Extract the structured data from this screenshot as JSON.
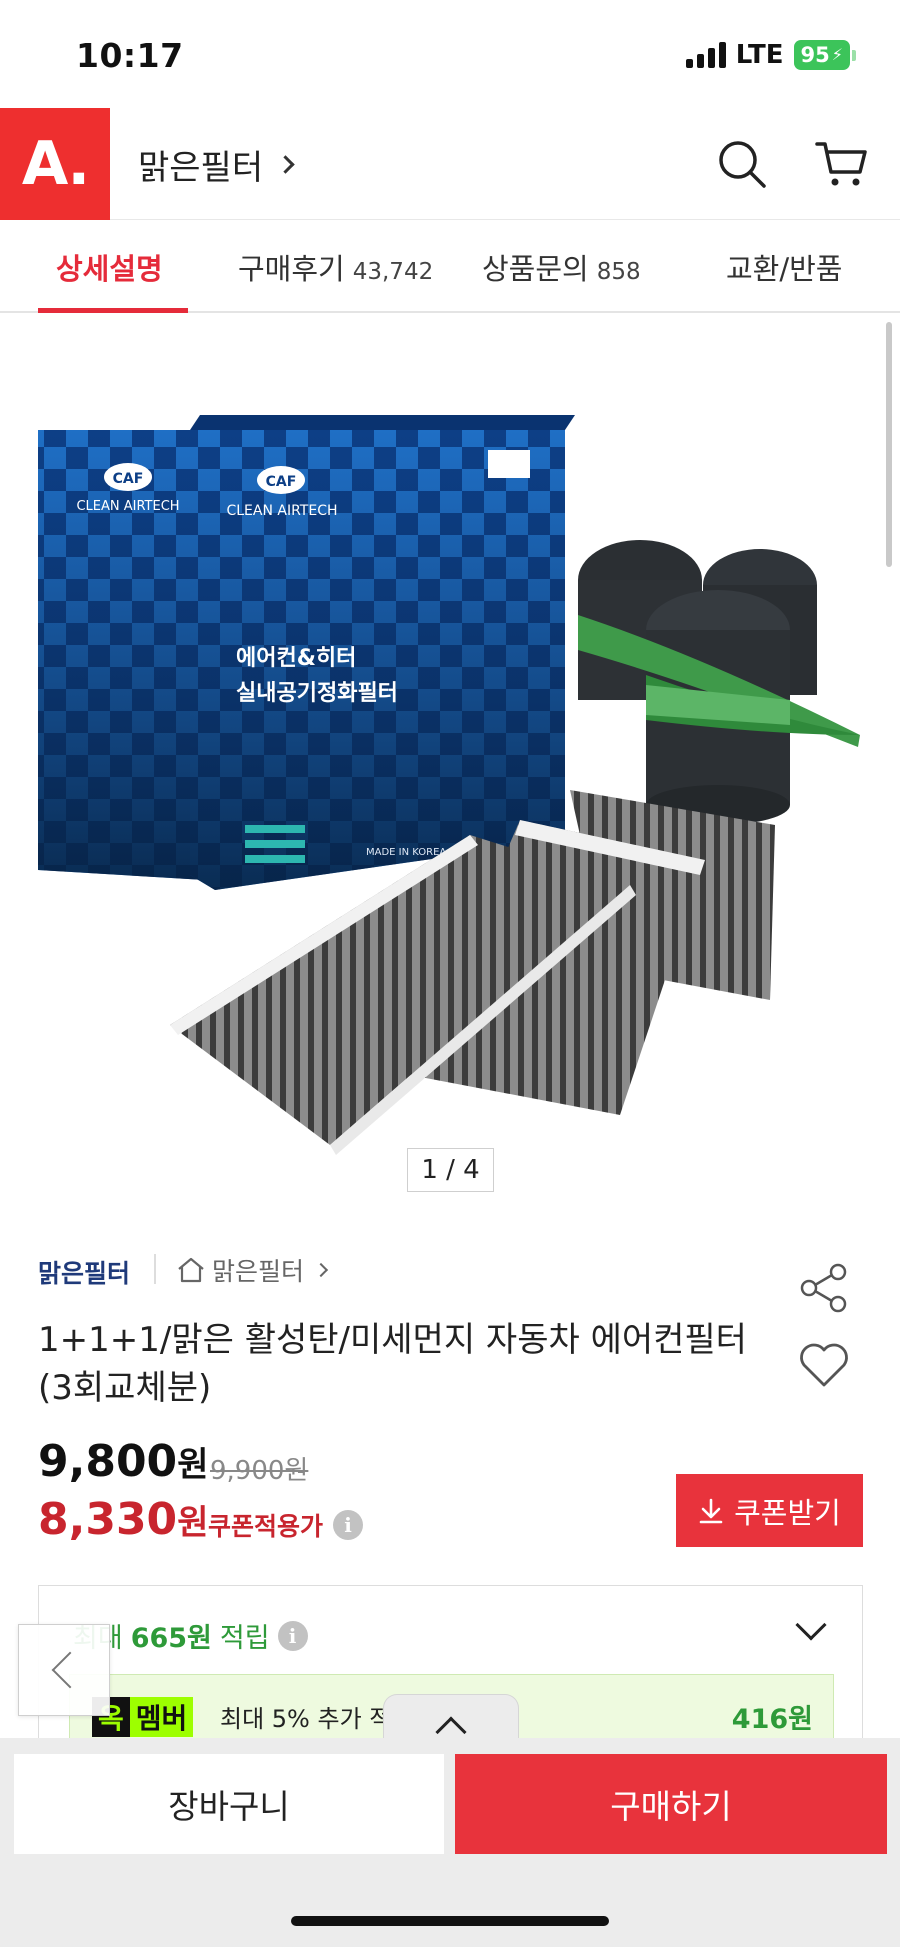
{
  "status_bar": {
    "time": "10:17",
    "network": "LTE",
    "battery": "95"
  },
  "header": {
    "logo_text": "A.",
    "store_title": "맑은필터"
  },
  "tabs": [
    {
      "label": "상세설명",
      "count": ""
    },
    {
      "label": "구매후기",
      "count": "43,742"
    },
    {
      "label": "상품문의",
      "count": "858"
    },
    {
      "label": "교환/반품",
      "count": ""
    }
  ],
  "gallery": {
    "counter": "1 / 4",
    "box_brand": "CAF",
    "box_brand_sub": "CLEAN AIRTECH",
    "box_text_1": "에어컨&히터",
    "box_text_2": "실내공기정화필터",
    "box_made": "MADE IN KOREA"
  },
  "product": {
    "brand": "맑은필터",
    "store": "맑은필터",
    "title": "1+1+1/맑은 활성탄/미세먼지 자동차 에어컨필터 (3회교체분)",
    "price": "9,800",
    "price_unit": "원",
    "original_price": "9,900원",
    "coupon_price": "8,330",
    "coupon_price_unit": "원",
    "coupon_label": "쿠폰적용가",
    "coupon_button": "쿠폰받기",
    "info_glyph": "i"
  },
  "points": {
    "prefix": "최대",
    "amount": "665원",
    "suffix": "적립",
    "member_tag_1": "옥",
    "member_tag_2": "멤버",
    "member_text": "최대 5% 추가 적",
    "member_amount": "416원"
  },
  "bottom_bar": {
    "cart": "장바구니",
    "buy": "구매하기"
  },
  "colors": {
    "brand_red": "#ee2f2f",
    "accent_red": "#e8333c",
    "points_green": "#2e9a39",
    "member_lime": "#9dff00"
  }
}
